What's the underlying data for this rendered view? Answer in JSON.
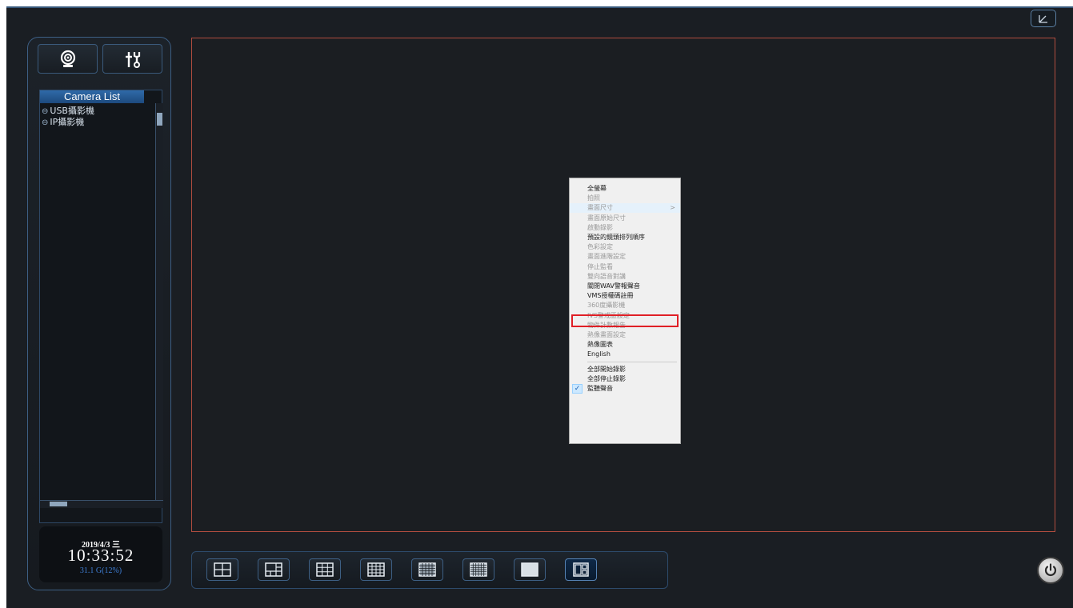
{
  "colors": {
    "background": "#1a1e23",
    "panel_border": "#3d5f84",
    "video_border": "#b14d3f",
    "highlight": "#e01f26",
    "accent_blue": "#3f7fd6"
  },
  "header": {
    "restore_icon": "restore-window-icon"
  },
  "sidebar": {
    "camera_icon": "webcam-icon",
    "settings_icon": "tools-icon",
    "camera_list_title": "Camera List",
    "tree_items": [
      {
        "label": "USB攝影機",
        "icon": "collapse-circle-icon"
      },
      {
        "label": "IP攝影機",
        "icon": "collapse-circle-icon"
      }
    ]
  },
  "clock": {
    "date": "2019/4/3 三",
    "time": "10:33:52",
    "disk": "31.1 G(12%)"
  },
  "context_menu": {
    "items": [
      {
        "label": "全螢幕",
        "enabled": true
      },
      {
        "label": "拍照",
        "enabled": false
      },
      {
        "label": "畫面尺寸",
        "enabled": false,
        "submenu": true
      },
      {
        "label": "畫面原始尺寸",
        "enabled": false
      },
      {
        "label": "啟動錄影",
        "enabled": false
      },
      {
        "label": "預設的鏡頭排列順序",
        "enabled": true
      },
      {
        "label": "色彩設定",
        "enabled": false
      },
      {
        "label": "畫面進階設定",
        "enabled": false
      },
      {
        "label": "停止監看",
        "enabled": false
      },
      {
        "label": "雙向語音對講",
        "enabled": false
      },
      {
        "label": "關閉WAV警報聲音",
        "enabled": true
      },
      {
        "label": "VMS授權碼註冊",
        "enabled": true
      },
      {
        "label": "360度攝影機",
        "enabled": false
      },
      {
        "label": "IVS警戒區設定",
        "enabled": false
      },
      {
        "label": "物件計數報告",
        "enabled": false
      },
      {
        "label": "熱像畫面設定",
        "enabled": false
      },
      {
        "label": "熱像圖表",
        "enabled": true
      },
      {
        "label": "English",
        "enabled": true
      },
      {
        "label": "全部開始錄影",
        "enabled": true
      },
      {
        "label": "全部停止錄影",
        "enabled": true
      },
      {
        "label": "監聽聲音",
        "enabled": true,
        "checked": true
      }
    ],
    "submenu_arrow": ">",
    "check_mark": "✓"
  },
  "layout_bar": {
    "buttons": [
      {
        "icon": "grid-2x2-icon",
        "active": false
      },
      {
        "icon": "grid-1-plus-3-icon",
        "active": false
      },
      {
        "icon": "grid-3x3-icon",
        "active": false
      },
      {
        "icon": "grid-4x4-icon",
        "active": false
      },
      {
        "icon": "grid-5x5-icon",
        "active": false
      },
      {
        "icon": "grid-6x6-icon",
        "active": false
      },
      {
        "icon": "grid-8x8-icon",
        "active": false
      },
      {
        "icon": "custom-layout-icon",
        "active": true
      }
    ]
  },
  "power_icon": "power-icon"
}
